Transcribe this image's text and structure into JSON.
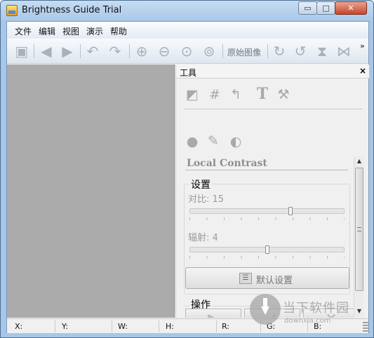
{
  "window": {
    "title": "Brightness Guide Trial",
    "controls": {
      "minimize": "▭",
      "maximize": "□",
      "close": "✕"
    }
  },
  "menu": [
    "文件",
    "编辑",
    "视图",
    "演示",
    "帮助"
  ],
  "toolbar": {
    "icons": [
      "save-icon",
      "back-arrow-icon",
      "forward-arrow-icon",
      "undo-icon",
      "redo-icon",
      "zoom-in-icon",
      "zoom-out-icon",
      "zoom-fit-icon",
      "zoom-actual-icon",
      "rotate-right-icon",
      "rotate-left-icon",
      "flip-vertical-icon",
      "flip-horizontal-icon"
    ],
    "original_image_label": "原始图像",
    "overflow": "»"
  },
  "panel": {
    "title": "工具",
    "close": "×",
    "section_title": "Local Contrast",
    "settings_group": "设置",
    "contrast_label": "对比: 15",
    "contrast_value": 15,
    "radius_label": "辐射: 4",
    "radius_value": 4,
    "default_button": "默认设置",
    "operations_group": "操作"
  },
  "statusbar": {
    "x": "X:",
    "y": "Y:",
    "w": "W:",
    "h": "H:",
    "r": "R:",
    "g": "G:",
    "b": "B:"
  },
  "watermark": {
    "text": "当下软件园",
    "url": "downxia.com"
  },
  "colors": {
    "titlebar": "#b4d0ed",
    "canvas": "#ababab",
    "disabled_icon": "#a8b1bc"
  }
}
